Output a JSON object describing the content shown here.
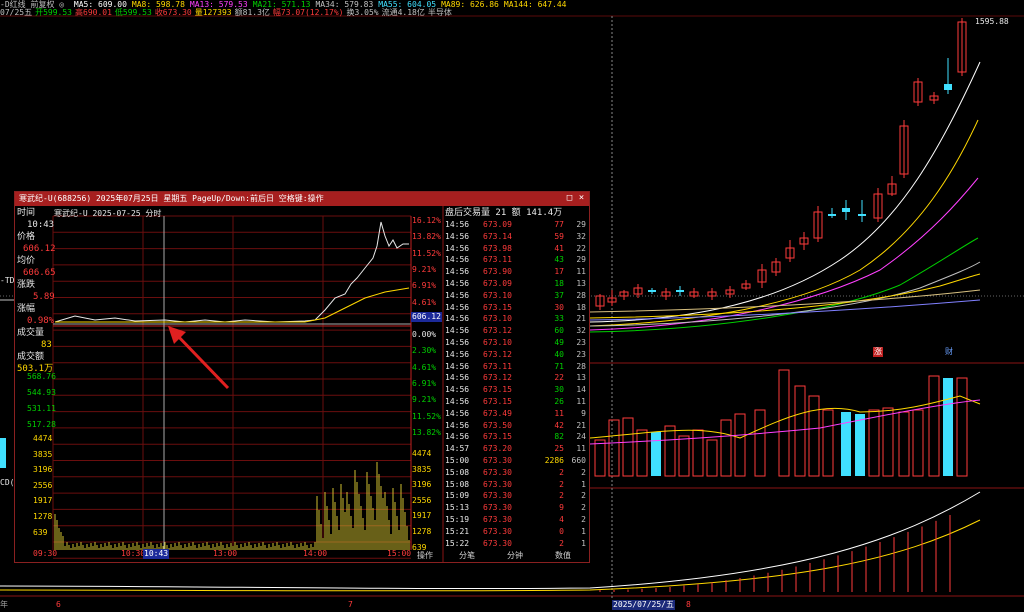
{
  "top_bar": {
    "line1_left": "-D红线 前复权 ◎",
    "line1_items": [
      {
        "label": "MA5: 609.00",
        "color": "#ffffff"
      },
      {
        "label": "MA8: 598.78",
        "color": "#ffd800"
      },
      {
        "label": "MA13: 579.53",
        "color": "#ff40ff"
      },
      {
        "label": "MA21: 571.13",
        "color": "#00d000"
      },
      {
        "label": "MA34: 579.83",
        "color": "#c0c0c0"
      },
      {
        "label": "MA55: 604.05",
        "color": "#40e0ff"
      },
      {
        "label": "MA89: 626.86",
        "color": "#ffd800"
      },
      {
        "label": "MA144: 647.44",
        "color": "#ffd800"
      }
    ],
    "line2": [
      {
        "label": "07/25五",
        "color": "#c0c0c0"
      },
      {
        "label": "开599.53",
        "color": "#00d000"
      },
      {
        "label": "高690.01",
        "color": "#ff3b3b"
      },
      {
        "label": "低599.53",
        "color": "#00d000"
      },
      {
        "label": "收673.30",
        "color": "#ff3b3b"
      },
      {
        "label": "量127393",
        "color": "#ffd800"
      },
      {
        "label": "额81.3亿",
        "color": "#c0c0c0"
      },
      {
        "label": "幅73.07(12.17%)",
        "color": "#ff3b3b"
      },
      {
        "label": "换3.05%",
        "color": "#c0c0c0"
      },
      {
        "label": "流通4.18亿",
        "color": "#c0c0c0"
      },
      {
        "label": "半导体",
        "color": "#c0c0c0"
      }
    ]
  },
  "main_chart": {
    "high_label": "1595.88",
    "left_labels": [
      "-TD",
      "CD("
    ],
    "marker_rise": "涨",
    "marker_fin": "财",
    "date_axis": [
      "6",
      "7",
      "2025/07/25/五",
      "8"
    ],
    "bottom_left": "年"
  },
  "popup": {
    "title": "寒武纪-U(688256)  2025年07月25日 星期五  PageUp/Down:前后日  空格键:操作",
    "chart_title": "寒武纪-U  2025-07-25 分时",
    "left_panel": {
      "time_label": "时间",
      "time_value": "10:43",
      "price_label": "价格",
      "price_value": "606.12",
      "avg_label": "均价",
      "avg_value": "606.65",
      "change_label": "涨跌",
      "change_value": "5.89",
      "pct_label": "涨幅",
      "pct_value": "0.98%",
      "vol_label": "成交量",
      "vol_value": "83",
      "amt_label": "成交额",
      "amt_value": "503.1万"
    },
    "price_axis_left": [
      "568.76",
      "544.93",
      "531.11",
      "517.28"
    ],
    "pct_axis_right": [
      "16.12%",
      "13.82%",
      "11.52%",
      "9.21%",
      "6.91%",
      "4.61%",
      "2.30%",
      "0.00%",
      "2.30%",
      "4.61%",
      "6.91%",
      "9.21%",
      "11.52%",
      "13.82%"
    ],
    "current_price_tag": "606.12",
    "volume_axis_left": [
      "4474",
      "3835",
      "3196",
      "2556",
      "1917",
      "1278",
      "639"
    ],
    "volume_axis_right": [
      "4474",
      "3835",
      "3196",
      "2556",
      "1917",
      "1278",
      "639"
    ],
    "time_axis": [
      "09:30",
      "10:30",
      "10:43",
      "13:00",
      "14:00",
      "15:00"
    ],
    "tabs": [
      "操作",
      "分笔",
      "分钟",
      "数值"
    ],
    "trades_header": "盘后交易量 21 额 141.4万",
    "trades": [
      {
        "time": "14:56",
        "price": "673.09",
        "vol": "77",
        "n": "29",
        "dir": "red"
      },
      {
        "time": "14:56",
        "price": "673.14",
        "vol": "59",
        "n": "32",
        "dir": "red"
      },
      {
        "time": "14:56",
        "price": "673.98",
        "vol": "41",
        "n": "22",
        "dir": "red"
      },
      {
        "time": "14:56",
        "price": "673.11",
        "vol": "43",
        "n": "29",
        "dir": "green"
      },
      {
        "time": "14:56",
        "price": "673.90",
        "vol": "17",
        "n": "11",
        "dir": "red"
      },
      {
        "time": "14:56",
        "price": "673.09",
        "vol": "18",
        "n": "13",
        "dir": "green"
      },
      {
        "time": "14:56",
        "price": "673.10",
        "vol": "37",
        "n": "28",
        "dir": "green"
      },
      {
        "time": "14:56",
        "price": "673.15",
        "vol": "30",
        "n": "18",
        "dir": "red"
      },
      {
        "time": "14:56",
        "price": "673.10",
        "vol": "33",
        "n": "21",
        "dir": "green"
      },
      {
        "time": "14:56",
        "price": "673.12",
        "vol": "60",
        "n": "32",
        "dir": "green"
      },
      {
        "time": "14:56",
        "price": "673.10",
        "vol": "49",
        "n": "23",
        "dir": "green"
      },
      {
        "time": "14:56",
        "price": "673.12",
        "vol": "40",
        "n": "23",
        "dir": "green"
      },
      {
        "time": "14:56",
        "price": "673.11",
        "vol": "71",
        "n": "28",
        "dir": "green"
      },
      {
        "time": "14:56",
        "price": "673.12",
        "vol": "22",
        "n": "13",
        "dir": "red"
      },
      {
        "time": "14:56",
        "price": "673.15",
        "vol": "30",
        "n": "14",
        "dir": "green"
      },
      {
        "time": "14:56",
        "price": "673.15",
        "vol": "26",
        "n": "11",
        "dir": "green"
      },
      {
        "time": "14:56",
        "price": "673.49",
        "vol": "11",
        "n": "9",
        "dir": "red"
      },
      {
        "time": "14:56",
        "price": "673.50",
        "vol": "42",
        "n": "21",
        "dir": "red"
      },
      {
        "time": "14:56",
        "price": "673.15",
        "vol": "82",
        "n": "24",
        "dir": "green"
      },
      {
        "time": "14:57",
        "price": "673.20",
        "vol": "25",
        "n": "11",
        "dir": "red"
      },
      {
        "time": "15:00",
        "price": "673.30",
        "vol": "2286",
        "n": "660",
        "dir": "yellow"
      },
      {
        "time": "15:08",
        "price": "673.30",
        "vol": "2",
        "n": "2",
        "dir": "red"
      },
      {
        "time": "15:08",
        "price": "673.30",
        "vol": "2",
        "n": "1",
        "dir": "red"
      },
      {
        "time": "15:09",
        "price": "673.30",
        "vol": "2",
        "n": "2",
        "dir": "red"
      },
      {
        "time": "15:13",
        "price": "673.30",
        "vol": "9",
        "n": "2",
        "dir": "red"
      },
      {
        "time": "15:19",
        "price": "673.30",
        "vol": "4",
        "n": "2",
        "dir": "red"
      },
      {
        "time": "15:21",
        "price": "673.30",
        "vol": "0",
        "n": "1",
        "dir": "red"
      },
      {
        "time": "15:22",
        "price": "673.30",
        "vol": "2",
        "n": "1",
        "dir": "red"
      }
    ]
  },
  "colors": {
    "up": "#ff3b3b",
    "down": "#00d000",
    "grid": "#6a0e0e",
    "title_bar": "#a61f1f",
    "arrow": "#e02020"
  }
}
